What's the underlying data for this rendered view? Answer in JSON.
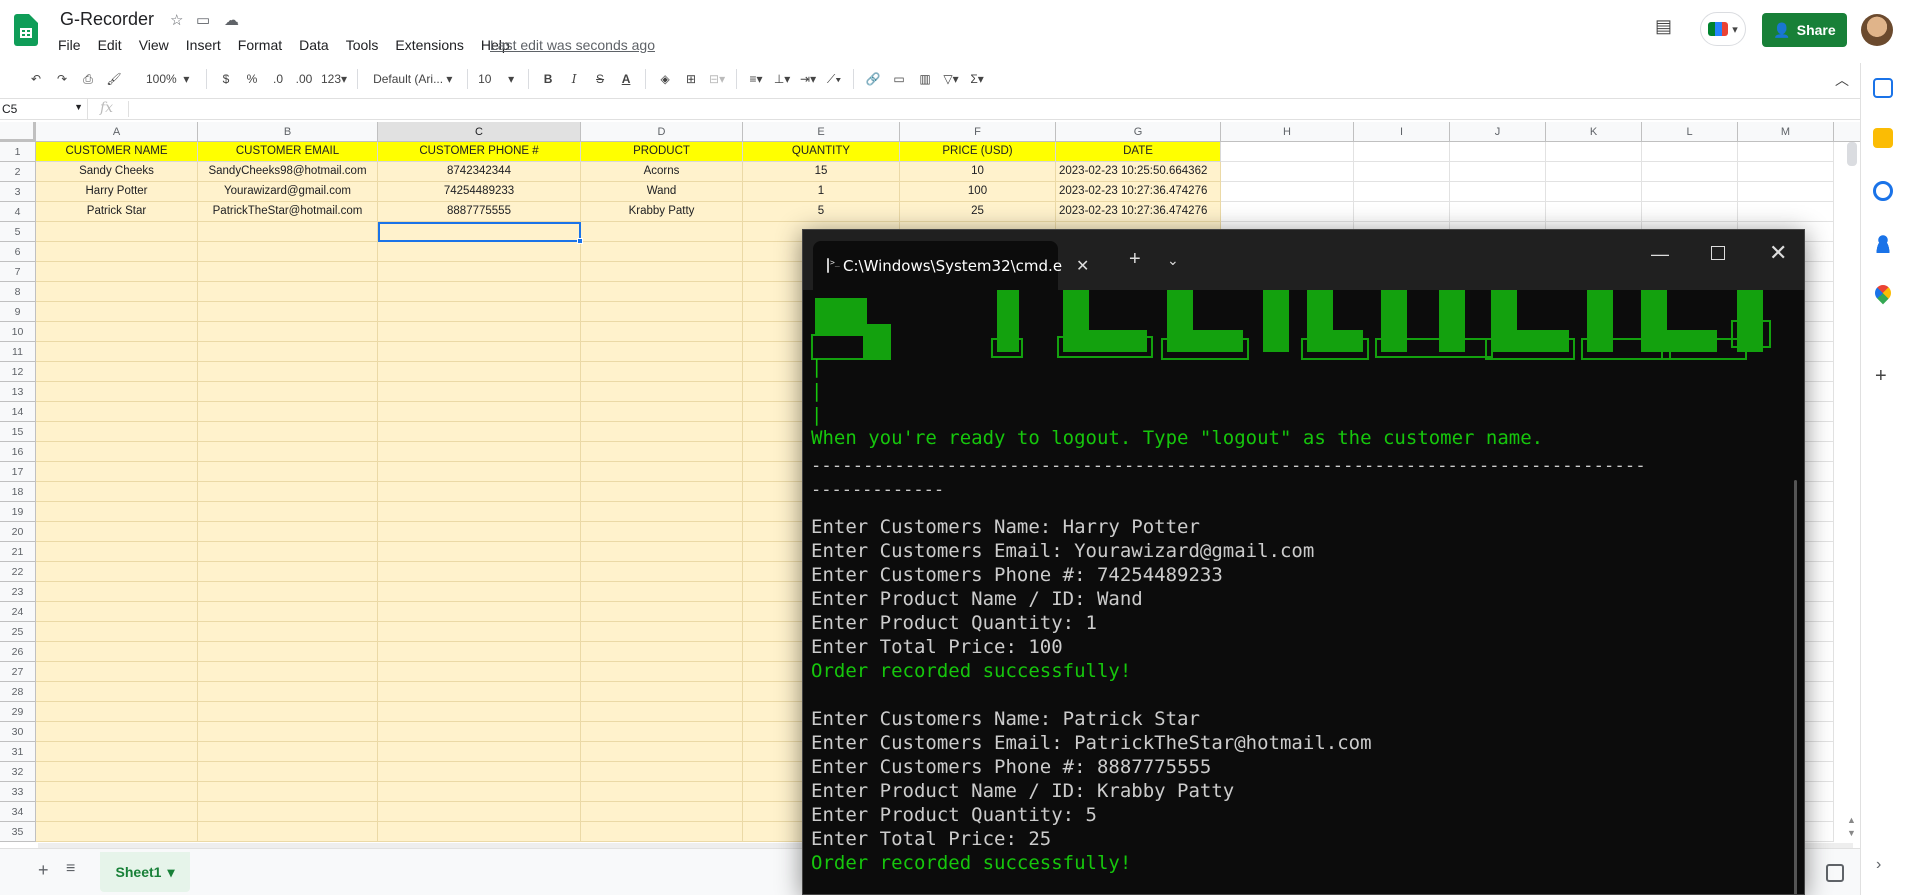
{
  "app": {
    "title": "G-Recorder",
    "menu": [
      "File",
      "Edit",
      "View",
      "Insert",
      "Format",
      "Data",
      "Tools",
      "Extensions",
      "Help"
    ],
    "last_edit": "Last edit was seconds ago",
    "share_label": "Share"
  },
  "toolbar": {
    "zoom": "100%",
    "currency": "$",
    "percent": "%",
    "dec_less": ".0",
    "dec_more": ".00",
    "format_more": "123",
    "font": "Default (Ari...",
    "font_size": "10"
  },
  "formula_bar": {
    "name_box": "C5",
    "fx": "fx"
  },
  "sheet": {
    "columns": [
      "A",
      "B",
      "C",
      "D",
      "E",
      "F",
      "G",
      "H",
      "I",
      "J",
      "K",
      "L",
      "M"
    ],
    "selected_column": "C",
    "header_row": [
      "CUSTOMER NAME",
      "CUSTOMER EMAIL",
      "CUSTOMER PHONE #",
      "PRODUCT",
      "QUANTITY",
      "PRICE (USD)",
      "DATE"
    ],
    "rows": [
      [
        "Sandy Cheeks",
        "SandyCheeks98@hotmail.com",
        "8742342344",
        "Acorns",
        "15",
        "10",
        "2023-02-23 10:25:50.664362"
      ],
      [
        "Harry Potter",
        "Yourawizard@gmail.com",
        "74254489233",
        "Wand",
        "1",
        "100",
        "2023-02-23 10:27:36.474276"
      ],
      [
        "Patrick Star",
        "PatrickTheStar@hotmail.com",
        "8887775555",
        "Krabby Patty",
        "5",
        "25",
        "2023-02-23 10:27:36.474276"
      ]
    ],
    "row_count": 35,
    "sheet_tab": "Sheet1",
    "colors": {
      "header_fill": "#ffff00",
      "data_fill": "#fff2cc",
      "selection": "#1a73e8"
    }
  },
  "terminal": {
    "tab_title": "C:\\Windows\\System32\\cmd.e",
    "pipes": [
      "|",
      "|",
      "|"
    ],
    "logout_hint": "When you're ready to logout. Type \"logout\" as the customer name.",
    "divider_1": "--------------------------------------------------------------------------------",
    "divider_2": "-------------",
    "entries": [
      {
        "name": "Enter Customers Name: Harry Potter",
        "email": "Enter Customers Email: Yourawizard@gmail.com",
        "phone": "Enter Customers Phone #: 74254489233",
        "product": "Enter Product Name / ID: Wand",
        "quantity": "Enter Product Quantity: 1",
        "price": "Enter Total Price: 100",
        "success": "Order recorded successfully!"
      },
      {
        "name": "Enter Customers Name: Patrick Star",
        "email": "Enter Customers Email: PatrickTheStar@hotmail.com",
        "phone": "Enter Customers Phone #: 8887775555",
        "product": "Enter Product Name / ID: Krabby Patty",
        "quantity": "Enter Product Quantity: 5",
        "price": "Enter Total Price: 25",
        "success": "Order recorded successfully!"
      }
    ],
    "colors": {
      "background": "#0c0c0c",
      "green": "#16c60c",
      "text": "#cccccc"
    }
  }
}
